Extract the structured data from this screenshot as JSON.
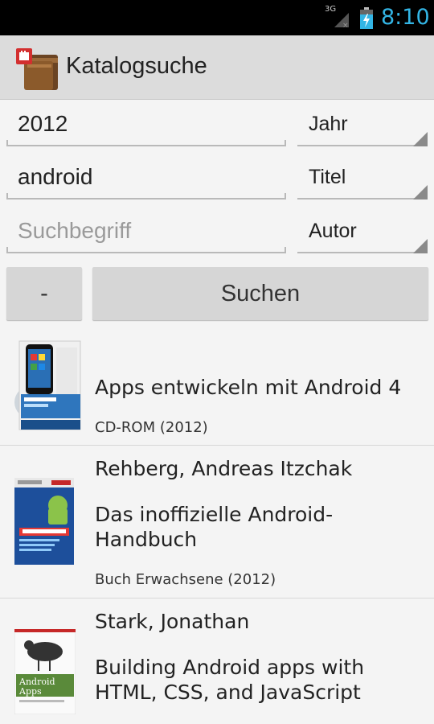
{
  "status_bar": {
    "network": "3G",
    "time": "8:10",
    "accent_color": "#33b5e5"
  },
  "action_bar": {
    "title": "Katalogsuche",
    "icon": "library-books-icon"
  },
  "search": {
    "rows": [
      {
        "value": "2012",
        "placeholder": "",
        "field_type": "Jahr"
      },
      {
        "value": "android",
        "placeholder": "",
        "field_type": "Titel"
      },
      {
        "value": "",
        "placeholder": "Suchbegriff",
        "field_type": "Autor"
      }
    ],
    "minus_label": "-",
    "submit_label": "Suchen"
  },
  "results": [
    {
      "author": "",
      "title": "Apps entwickeln mit Android 4",
      "meta": "CD-ROM (2012)",
      "cover_icon": "book-cover-cd-icon"
    },
    {
      "author": "Rehberg, Andreas Itzchak",
      "title": "Das inoffizielle Android-Handbuch",
      "meta": "Buch Erwachsene (2012)",
      "cover_icon": "book-cover-android-handbuch-icon"
    },
    {
      "author": "Stark, Jonathan",
      "title": "Building Android apps with HTML, CSS, and JavaScript",
      "meta": "",
      "cover_icon": "book-cover-oreilly-icon"
    }
  ]
}
